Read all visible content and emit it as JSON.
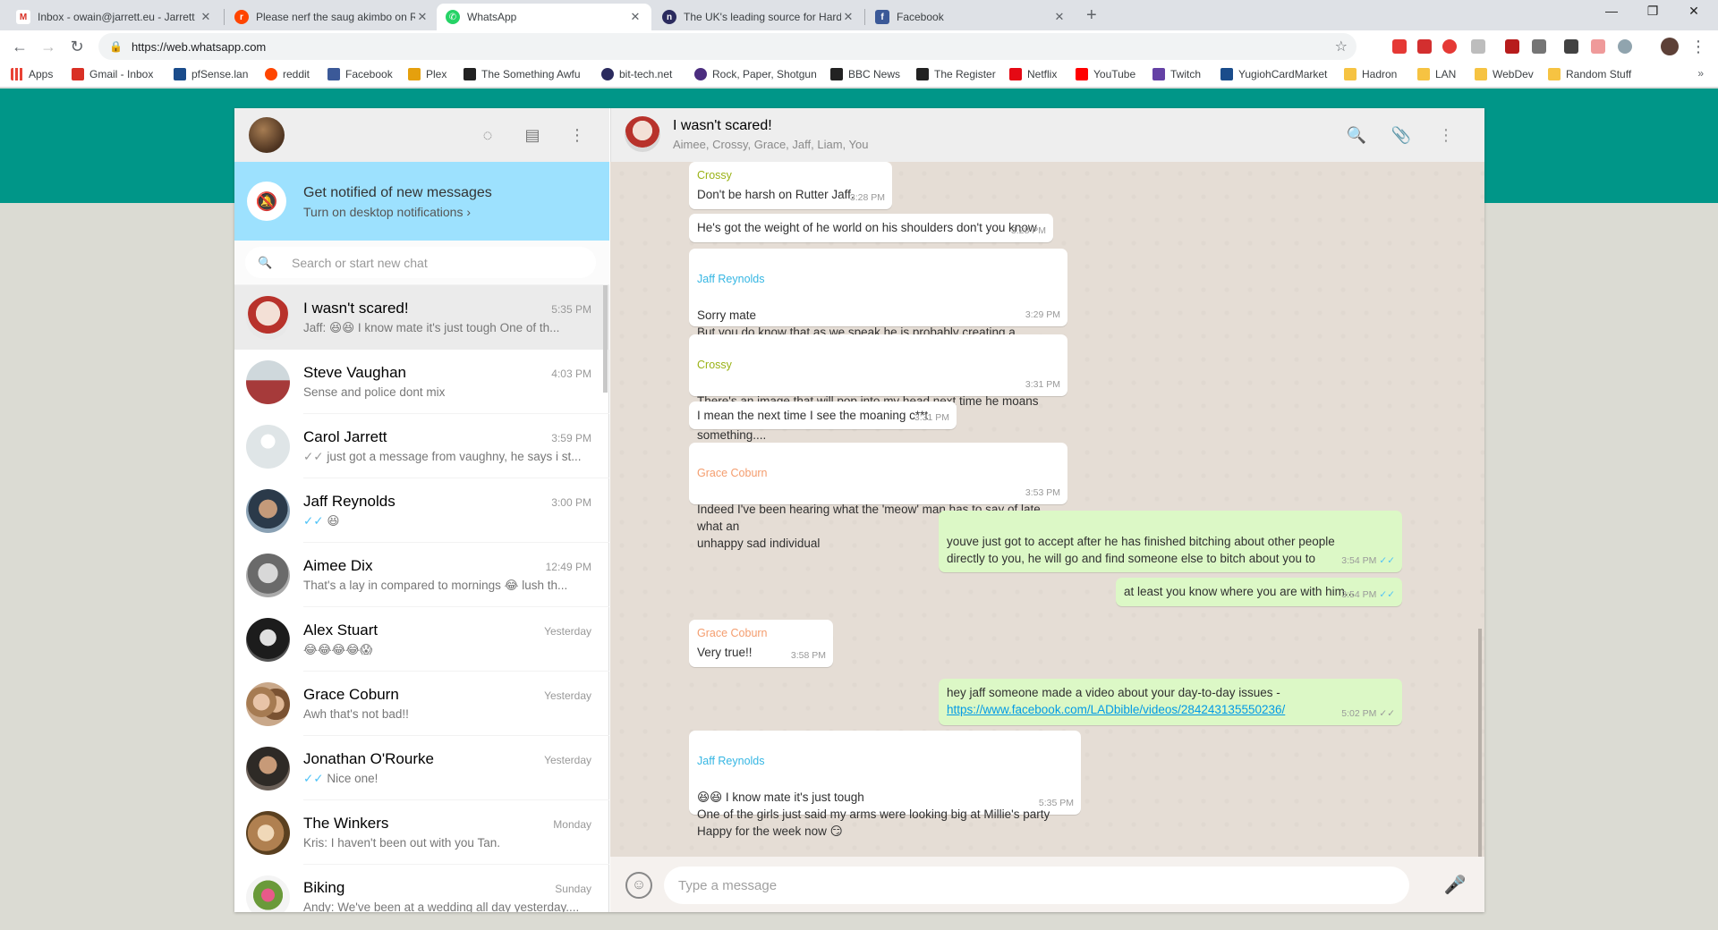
{
  "browser": {
    "tabs": [
      {
        "title": "Inbox - owain@jarrett.eu - Jarrett",
        "color": "#d93025",
        "glyph": "M"
      },
      {
        "title": "Please nerf the saug akimbo on R",
        "color": "#ff4500",
        "glyph": "r"
      },
      {
        "title": "WhatsApp",
        "color": "#25d366",
        "glyph": "W"
      },
      {
        "title": "The UK's leading source for Hard",
        "color": "#2b2b5e",
        "glyph": "n"
      },
      {
        "title": "Facebook",
        "color": "#3b5998",
        "glyph": "f"
      }
    ],
    "url": "https://web.whatsapp.com",
    "bookmarks": [
      {
        "label": "Apps",
        "color": "#e94235"
      },
      {
        "label": "Gmail - Inbox",
        "color": "#d93025"
      },
      {
        "label": "pfSense.lan",
        "color": "#1a4c8b"
      },
      {
        "label": "reddit",
        "color": "#ff4500"
      },
      {
        "label": "Facebook",
        "color": "#3b5998"
      },
      {
        "label": "Plex",
        "color": "#e5a00d"
      },
      {
        "label": "The Something Awful",
        "color": "#222222"
      },
      {
        "label": "bit-tech.net",
        "color": "#2b2b5e"
      },
      {
        "label": "Rock, Paper, Shotgun",
        "color": "#4b2d7f"
      },
      {
        "label": "BBC News",
        "color": "#222222"
      },
      {
        "label": "The Register",
        "color": "#222222"
      },
      {
        "label": "Netflix",
        "color": "#e50914"
      },
      {
        "label": "YouTube",
        "color": "#ff0000"
      },
      {
        "label": "Twitch",
        "color": "#6441a5"
      },
      {
        "label": "YugiohCardMarket",
        "color": "#1a4c8b"
      },
      {
        "label": "Hadron",
        "color": "#f6c342"
      },
      {
        "label": "LAN",
        "color": "#f6c342"
      },
      {
        "label": "WebDev",
        "color": "#f6c342"
      },
      {
        "label": "Random Stuff",
        "color": "#f6c342"
      }
    ],
    "bookmarks_more": "»"
  },
  "sidebar": {
    "notify_title": "Get notified of new messages",
    "notify_link": "Turn on desktop notifications ›",
    "search_placeholder": "Search or start new chat",
    "chats": [
      {
        "name": "I wasn't scared!",
        "time": "5:35 PM",
        "last": "Jaff: 😆😆 I know mate it's just tough One of th...",
        "ticks": "",
        "avatar": "#c9a6a0"
      },
      {
        "name": "Steve Vaughan",
        "time": "4:03 PM",
        "last": "Sense and police dont mix",
        "ticks": "",
        "avatar": "#a63a3a"
      },
      {
        "name": "Carol Jarrett",
        "time": "3:59 PM",
        "last": "just got a message from vaughny, he says i st...",
        "ticks": "✓✓",
        "avatar": "#dfe5e7"
      },
      {
        "name": "Jaff Reynolds",
        "time": "3:00 PM",
        "last": "😆",
        "ticks": "✓✓",
        "avatar": "#6b7d8e"
      },
      {
        "name": "Aimee Dix",
        "time": "12:49 PM",
        "last": "That's a lay in compared to mornings 😂 lush th...",
        "ticks": "",
        "avatar": "#8c8c8c"
      },
      {
        "name": "Alex Stuart",
        "time": "Yesterday",
        "last": "😂😂😂😂😱",
        "ticks": "",
        "avatar": "#3a3a3a"
      },
      {
        "name": "Grace Coburn",
        "time": "Yesterday",
        "last": "Awh that's not bad!!",
        "ticks": "",
        "avatar": "#b88a6a"
      },
      {
        "name": "Jonathan O'Rourke",
        "time": "Yesterday",
        "last": "Nice one!",
        "ticks": "✓✓",
        "avatar": "#4a4038"
      },
      {
        "name": "The Winkers",
        "time": "Monday",
        "last": "Kris: I haven't been out with you Tan.",
        "ticks": "",
        "avatar": "#9a7a52"
      },
      {
        "name": "Biking",
        "time": "Sunday",
        "last": "Andy: We've been at a wedding all day yesterday....",
        "ticks": "",
        "avatar": "#7a6a9a"
      }
    ]
  },
  "conversation": {
    "name": "I wasn't scared!",
    "members": "Aimee, Crossy, Grace, Jaff, Liam, You",
    "composer_placeholder": "Type a message",
    "sender_colors": {
      "Crossy": "#9ab216",
      "Jaff Reynolds": "#35b6e3",
      "Grace Coburn": "#f49d6e"
    },
    "messages": [
      {
        "dir": "in",
        "sender": "Crossy",
        "text": "Don't be harsh on Rutter Jaff.",
        "time": "3:28 PM"
      },
      {
        "dir": "in",
        "sender": "",
        "text": "He's got the weight of he world on his shoulders don't you know",
        "time": "3:28 PM"
      },
      {
        "dir": "in",
        "sender": "Jaff Reynolds",
        "text": "Sorry mate\nBut you do know that as we speak he is probably creating a miniature voodoo\ndoll of you and ramming it up his ass",
        "time": "3:29 PM"
      },
      {
        "dir": "in",
        "sender": "Crossy",
        "text": "There's an image that will pop into my head next time he moans about\nsomething....",
        "time": "3:31 PM"
      },
      {
        "dir": "in",
        "sender": "",
        "text": "I mean the next time I see the moaning c**t",
        "time": "3:31 PM"
      },
      {
        "dir": "in",
        "sender": "Grace Coburn",
        "text": "Indeed I've been hearing what the 'meow' man has to say of late... what an\nunhappy sad individual",
        "time": "3:53 PM"
      },
      {
        "dir": "out",
        "sender": "",
        "text": "youve just got to accept after he has finished bitching about other people\ndirectly to you, he will go and find someone else to bitch about you to",
        "time": "3:54 PM"
      },
      {
        "dir": "out",
        "sender": "",
        "text": "at least you know where you are with him...",
        "time": "3:54 PM"
      },
      {
        "dir": "in",
        "sender": "Grace Coburn",
        "text": "Very true!!",
        "time": "3:58 PM"
      },
      {
        "dir": "out",
        "sender": "",
        "text": "hey jaff someone made a video about your day-to-day issues -",
        "link": "https://www.facebook.com/LADbible/videos/284243135550236/",
        "time": "5:02 PM"
      },
      {
        "dir": "in",
        "sender": "Jaff Reynolds",
        "text": "😆😆 I know mate it's just tough\nOne of the girls just said my arms were looking big at Millie's party\nHappy for the week now 😏",
        "time": "5:35 PM"
      }
    ]
  }
}
